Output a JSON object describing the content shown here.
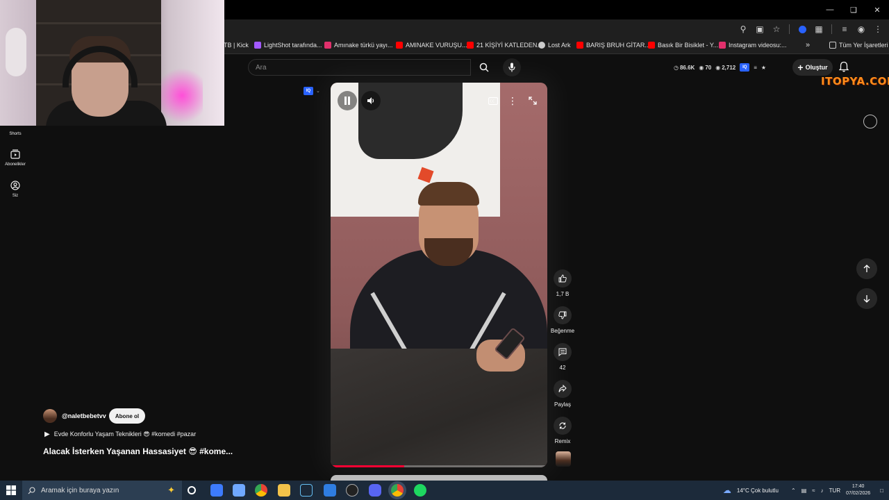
{
  "bookmarks": [
    {
      "label": "TB | Kick",
      "icon": "kick-icon",
      "color": "#53fc18"
    },
    {
      "label": "LightShot tarafında...",
      "icon": "lightshot-icon",
      "color": "#a259ff"
    },
    {
      "label": "Amınake türkü yayı...",
      "icon": "instagram-icon",
      "color": "#e1306c"
    },
    {
      "label": "AMINAKE VURUŞU...",
      "icon": "youtube-icon",
      "color": "#ff0000"
    },
    {
      "label": "21 KİŞİYİ KATLEDEN...",
      "icon": "youtube-icon",
      "color": "#ff0000"
    },
    {
      "label": "Lost Ark",
      "icon": "globe-icon",
      "color": "#cccccc"
    },
    {
      "label": "BARIŞ BRUH GİTAR...",
      "icon": "youtube-icon",
      "color": "#ff0000"
    },
    {
      "label": "Basık Bir Bisiklet - Y...",
      "icon": "youtube-icon",
      "color": "#ff0000"
    },
    {
      "label": "Instagram videosu:...",
      "icon": "instagram-icon",
      "color": "#e1306c"
    }
  ],
  "bookmarks_all": "Tüm Yer İşaretleri",
  "search": {
    "placeholder": "Ara"
  },
  "stats": {
    "views": "86.6K",
    "count": "70",
    "subs": "2,712"
  },
  "create_label": "Oluştur",
  "brand_badge": "ITOPYA.COM",
  "guide": {
    "shorts": "Shorts",
    "subscriptions": "Abonelikler",
    "you": "Siz"
  },
  "actions": {
    "like_count": "1,7 B",
    "dislike_label": "Beğenme",
    "comments_count": "42",
    "share_label": "Paylaş",
    "remix_label": "Remix"
  },
  "video": {
    "progress": 0.34
  },
  "meta": {
    "channel": "@naletbebetvv",
    "subscribe": "Abone ol",
    "description": "Evde Konforlu Yaşam Teknikleri 😎 #komedi #pazar",
    "title": "Alacak İsterken Yaşanan Hassasiyet 😎 #kome..."
  },
  "taskbar": {
    "search_placeholder": "Aramak için buraya yazın",
    "weather": "14°C  Çok bulutlu",
    "lang": "TUR",
    "time": "17:40",
    "date": "07/02/2026"
  },
  "colors": {
    "accent": "#ff0033",
    "iq": "#2962ff"
  }
}
